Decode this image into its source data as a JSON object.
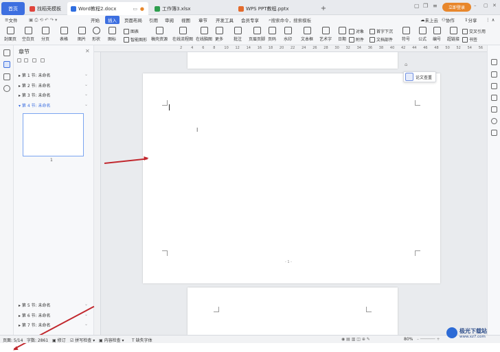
{
  "tabs": {
    "home": "首页",
    "t1": "找稻壳模板",
    "t2": "Word教程2.docx",
    "t3": "工作簿3.xlsx",
    "t4": "WPS PPT教程.pptx"
  },
  "tabbar_right": {
    "cloud": "未上云",
    "collab": "协作",
    "share": "分享",
    "login": "立即登录"
  },
  "menu": {
    "file": "文件",
    "items": [
      "开始",
      "插入",
      "页面布局",
      "引用",
      "审阅",
      "视图",
      "章节",
      "开发工具",
      "会员专享"
    ],
    "search": "搜索命令，搜索模板"
  },
  "toolbar": {
    "big": [
      "封面页",
      "空白页",
      "分页",
      "表格",
      "图片",
      "形状",
      "图标",
      "稿壳资源",
      "在线流程图",
      "在线脑图",
      "更多",
      "批注",
      "页眉页脚",
      "页码",
      "水印",
      "文本框",
      "艺术字",
      "日期",
      "附件",
      "文档部件",
      "符号",
      "公式",
      "编号",
      "超链接",
      "书签"
    ],
    "small": {
      "chart": "图表",
      "smart": "智能图形",
      "object": "对象",
      "dropcap": "首字下沉",
      "textbox": "文本框",
      "cross": "交叉引用"
    }
  },
  "nav": {
    "title": "章节",
    "sections": [
      "第 1 节: 未命名",
      "第 2 节: 未命名",
      "第 3 节: 未命名",
      "第 4 节: 未命名",
      "第 5 节: 未命名",
      "第 6 节: 未命名",
      "第 7 节: 未命名"
    ],
    "thumb_num": "1"
  },
  "ruler": {
    "ticks": [
      "2",
      "4",
      "6",
      "8",
      "10",
      "12",
      "14",
      "16",
      "18",
      "20",
      "22",
      "24",
      "26",
      "28",
      "30",
      "32",
      "34",
      "36",
      "38",
      "40",
      "42",
      "44",
      "46",
      "48",
      "50",
      "52",
      "54",
      "56",
      "58",
      "60",
      "62"
    ]
  },
  "canvas": {
    "lunwen": "论文查重",
    "page_footer": "- 1 -"
  },
  "status": {
    "page": "页面: 5/14",
    "words": "字数: 2861",
    "revise": "修订",
    "spell": "拼写检查",
    "content": "内容检查",
    "font": "缺失字体",
    "zoom": "80%"
  },
  "watermark": {
    "name": "极光下载站",
    "url": "www.xz7.com"
  },
  "colors": {
    "accent": "#3d6fe0",
    "login": "#e8872c",
    "arrow": "#c1272d"
  }
}
